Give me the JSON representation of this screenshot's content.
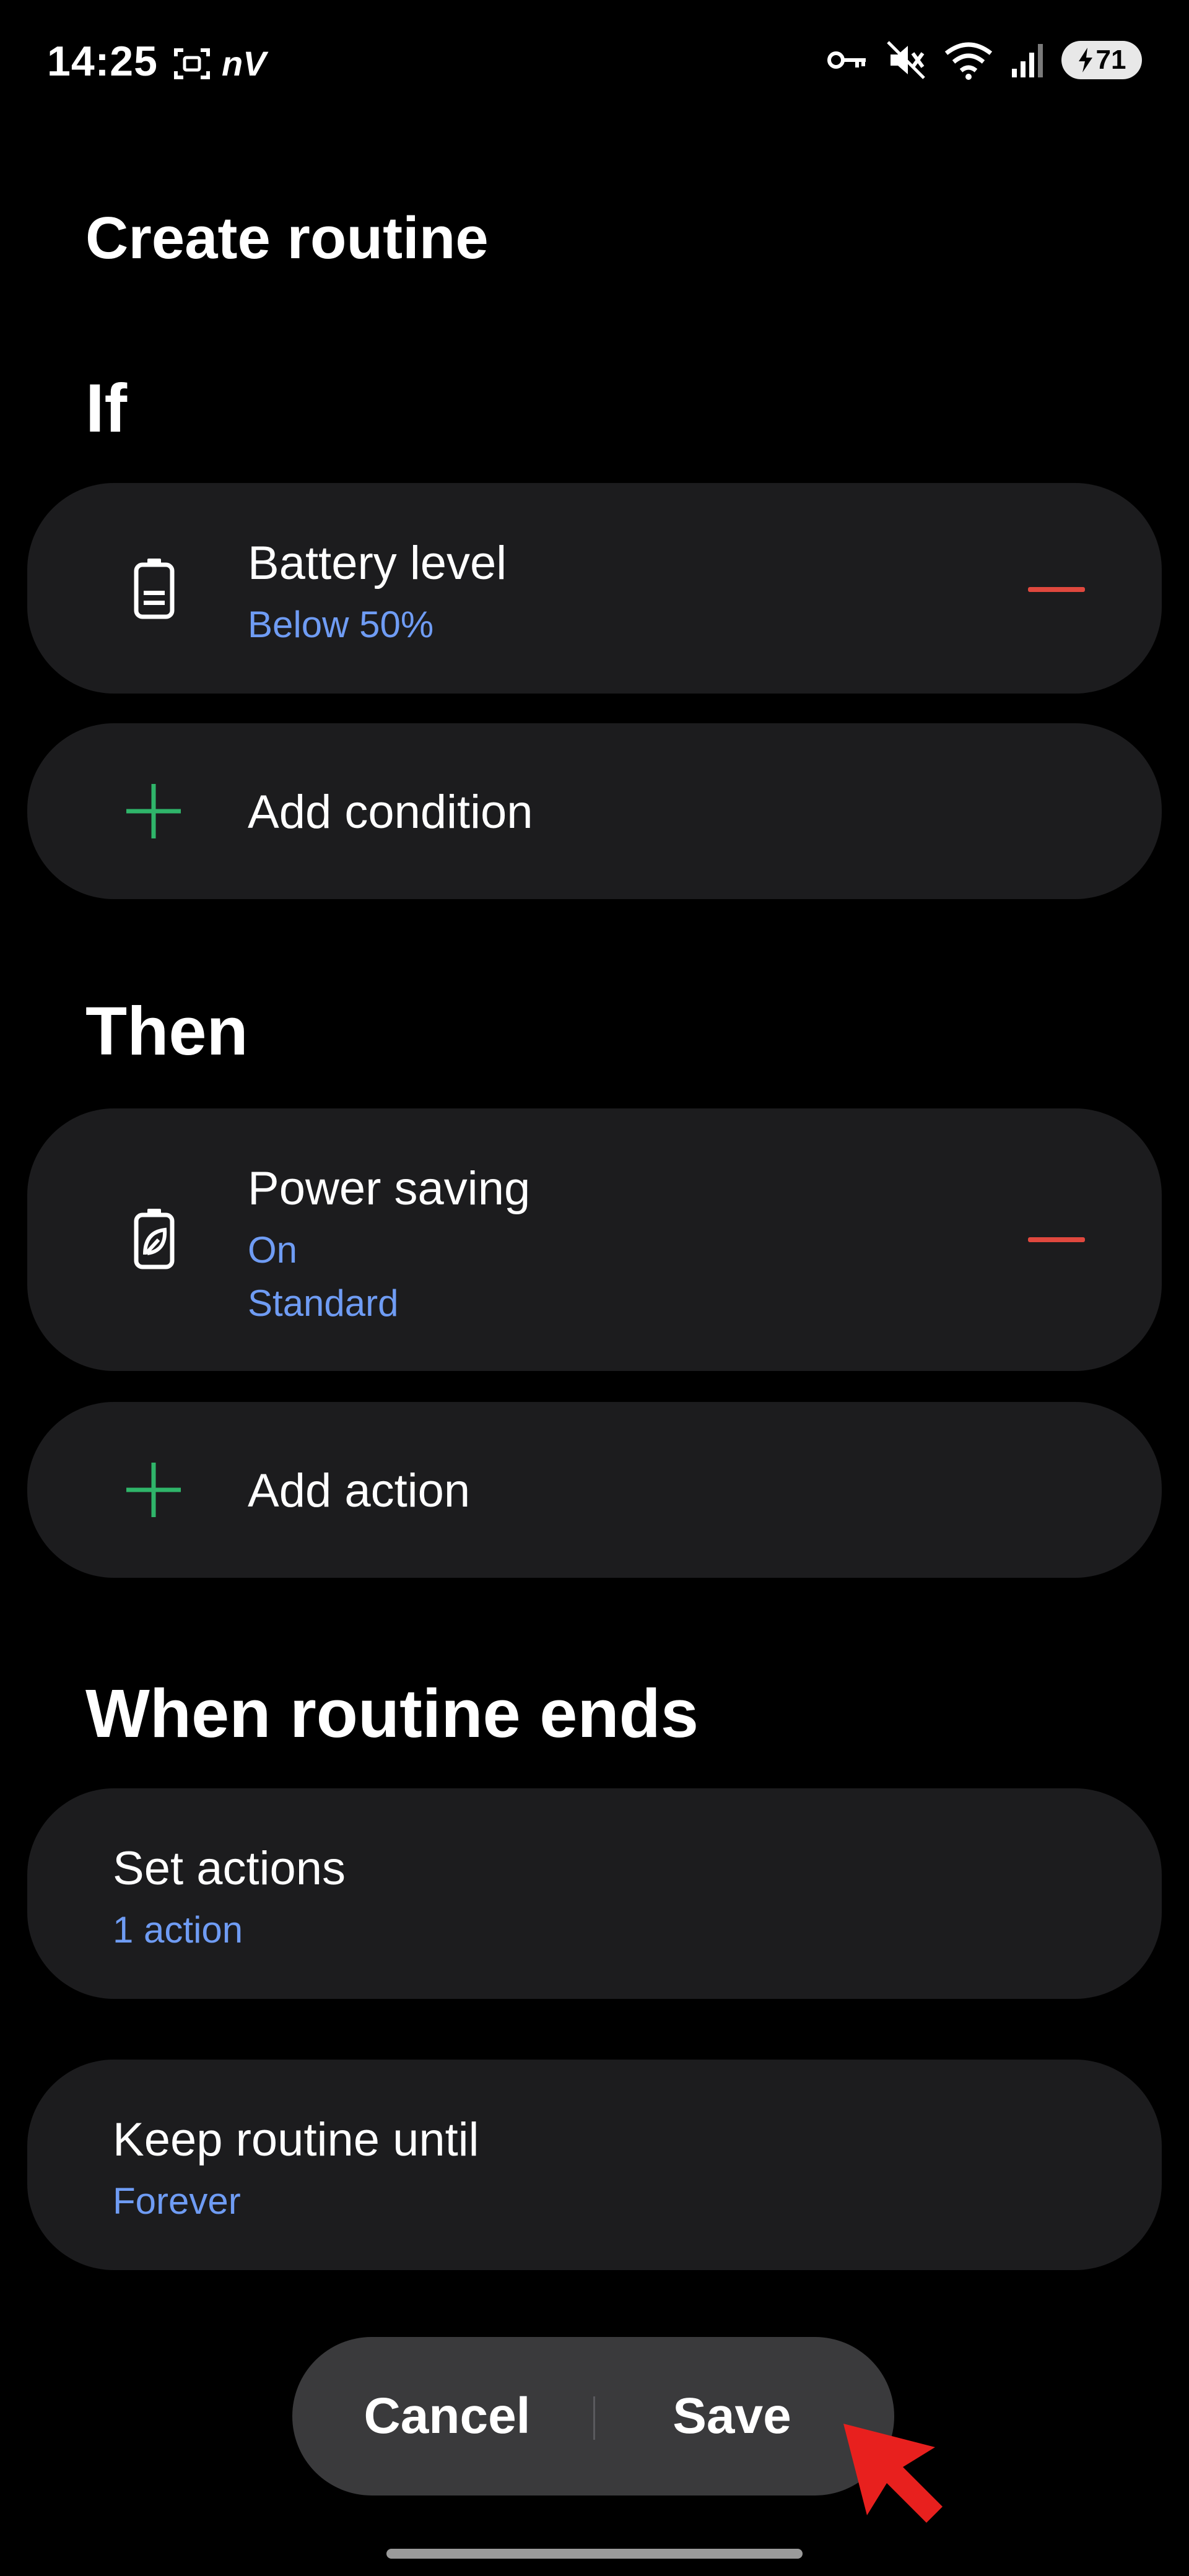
{
  "status_bar": {
    "time": "14:25",
    "carrier_label": "nV",
    "battery_level": "71",
    "icons": [
      "screenshot-icon",
      "vpn-key-icon",
      "mute-icon",
      "wifi-icon",
      "signal-icon",
      "battery-icon"
    ]
  },
  "page": {
    "title": "Create routine"
  },
  "if_section": {
    "title": "If",
    "condition": {
      "label": "Battery level",
      "value": "Below 50%",
      "icon": "battery-icon"
    },
    "add_label": "Add condition"
  },
  "then_section": {
    "title": "Then",
    "action": {
      "label": "Power saving",
      "value_1": "On",
      "value_2": "Standard",
      "icon": "battery-leaf-icon"
    },
    "add_label": "Add action"
  },
  "end_section": {
    "title": "When routine ends",
    "set_actions": {
      "label": "Set actions",
      "value": "1 action"
    },
    "keep_until": {
      "label": "Keep routine until",
      "value": "Forever"
    }
  },
  "bottom_bar": {
    "cancel_label": "Cancel",
    "save_label": "Save"
  },
  "colors": {
    "background": "#000000",
    "card": "#1c1c1e",
    "accent_blue": "#6f9cf4",
    "remove_red": "#e0483e",
    "add_green": "#2fb56a",
    "bottom_bar": "#3a3a3c",
    "cursor_red": "#e8201e"
  }
}
